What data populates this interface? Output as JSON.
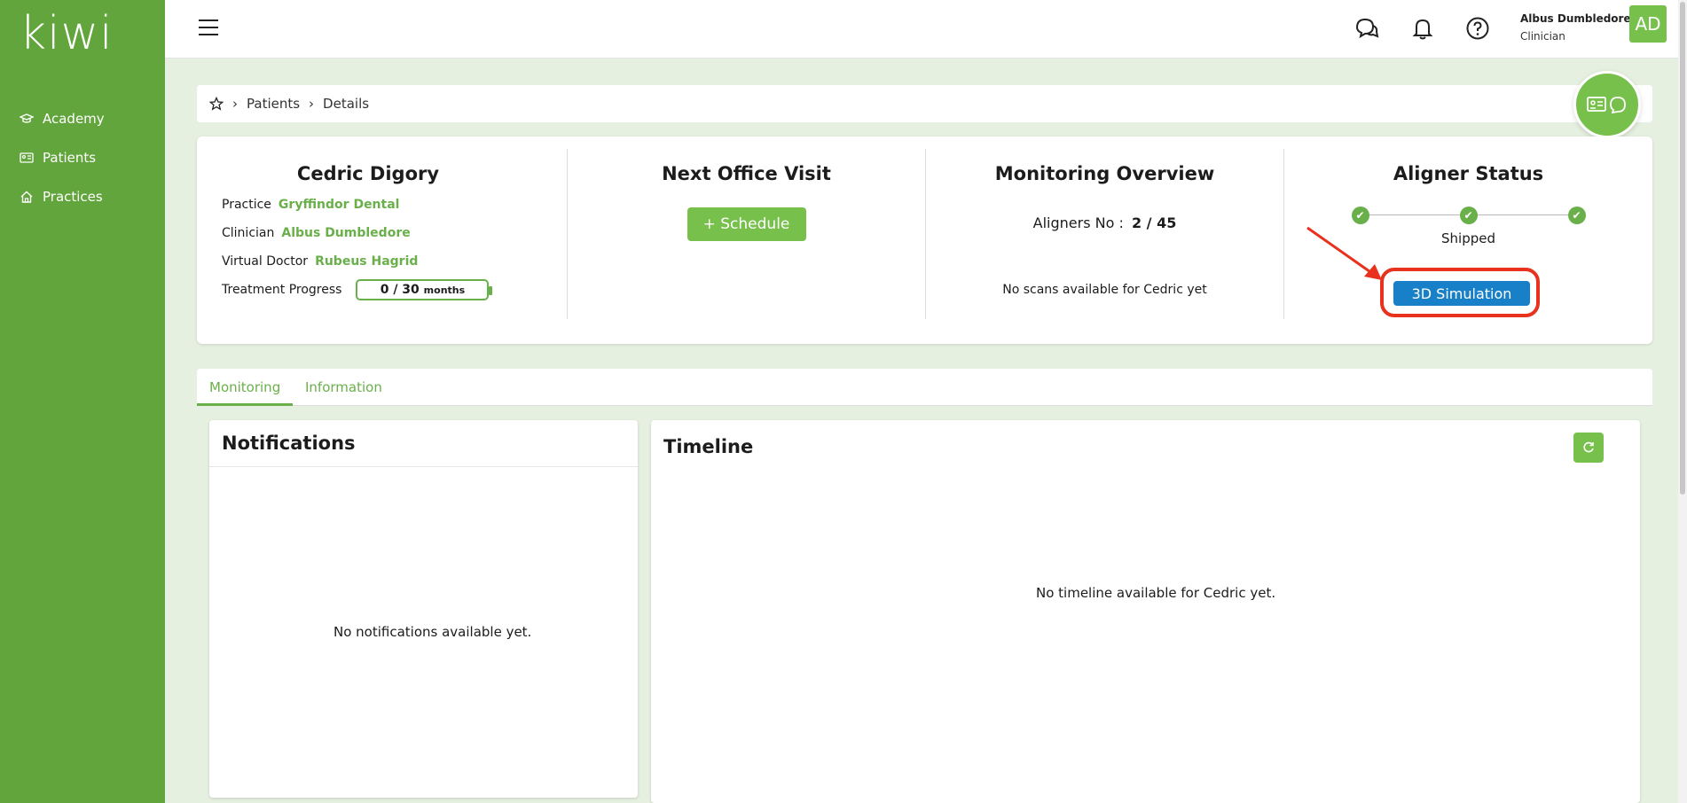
{
  "app": {
    "logo": "kiwi"
  },
  "sidebar": {
    "items": [
      {
        "label": "Academy",
        "icon": "graduation-cap-icon"
      },
      {
        "label": "Patients",
        "icon": "id-card-icon"
      },
      {
        "label": "Practices",
        "icon": "home-icon"
      }
    ]
  },
  "header": {
    "user_name": "Albus Dumbledore",
    "user_role": "Clinician",
    "avatar_initials": "AD"
  },
  "breadcrumb": {
    "items": [
      "Patients",
      "Details"
    ]
  },
  "patient": {
    "name": "Cedric Digory",
    "practice_label": "Practice",
    "practice": "Gryffindor Dental",
    "clinician_label": "Clinician",
    "clinician": "Albus Dumbledore",
    "virtual_doctor_label": "Virtual Doctor",
    "virtual_doctor": "Rubeus Hagrid",
    "treatment_label": "Treatment Progress",
    "treatment_value": "0 / 30",
    "treatment_unit": "months"
  },
  "next_visit": {
    "title": "Next Office Visit",
    "schedule_label": "+ Schedule"
  },
  "monitoring": {
    "title": "Monitoring Overview",
    "aligners_label": "Aligners No :",
    "aligners_value": "2 / 45",
    "no_scans": "No scans available for Cedric yet"
  },
  "aligner_status": {
    "title": "Aligner Status",
    "status_label": "Shipped",
    "simulation_label": "3D Simulation",
    "steps_completed": 3,
    "steps_total": 3
  },
  "tabs": [
    {
      "label": "Monitoring",
      "active": true
    },
    {
      "label": "Information",
      "active": false
    }
  ],
  "notifications": {
    "title": "Notifications",
    "empty": "No notifications available yet."
  },
  "timeline": {
    "title": "Timeline",
    "empty": "No timeline available for Cedric yet."
  },
  "colors": {
    "brand_green": "#62a53c",
    "accent_green": "#6ab04a",
    "button_blue": "#1880c8",
    "highlight_red": "#e8321e"
  }
}
